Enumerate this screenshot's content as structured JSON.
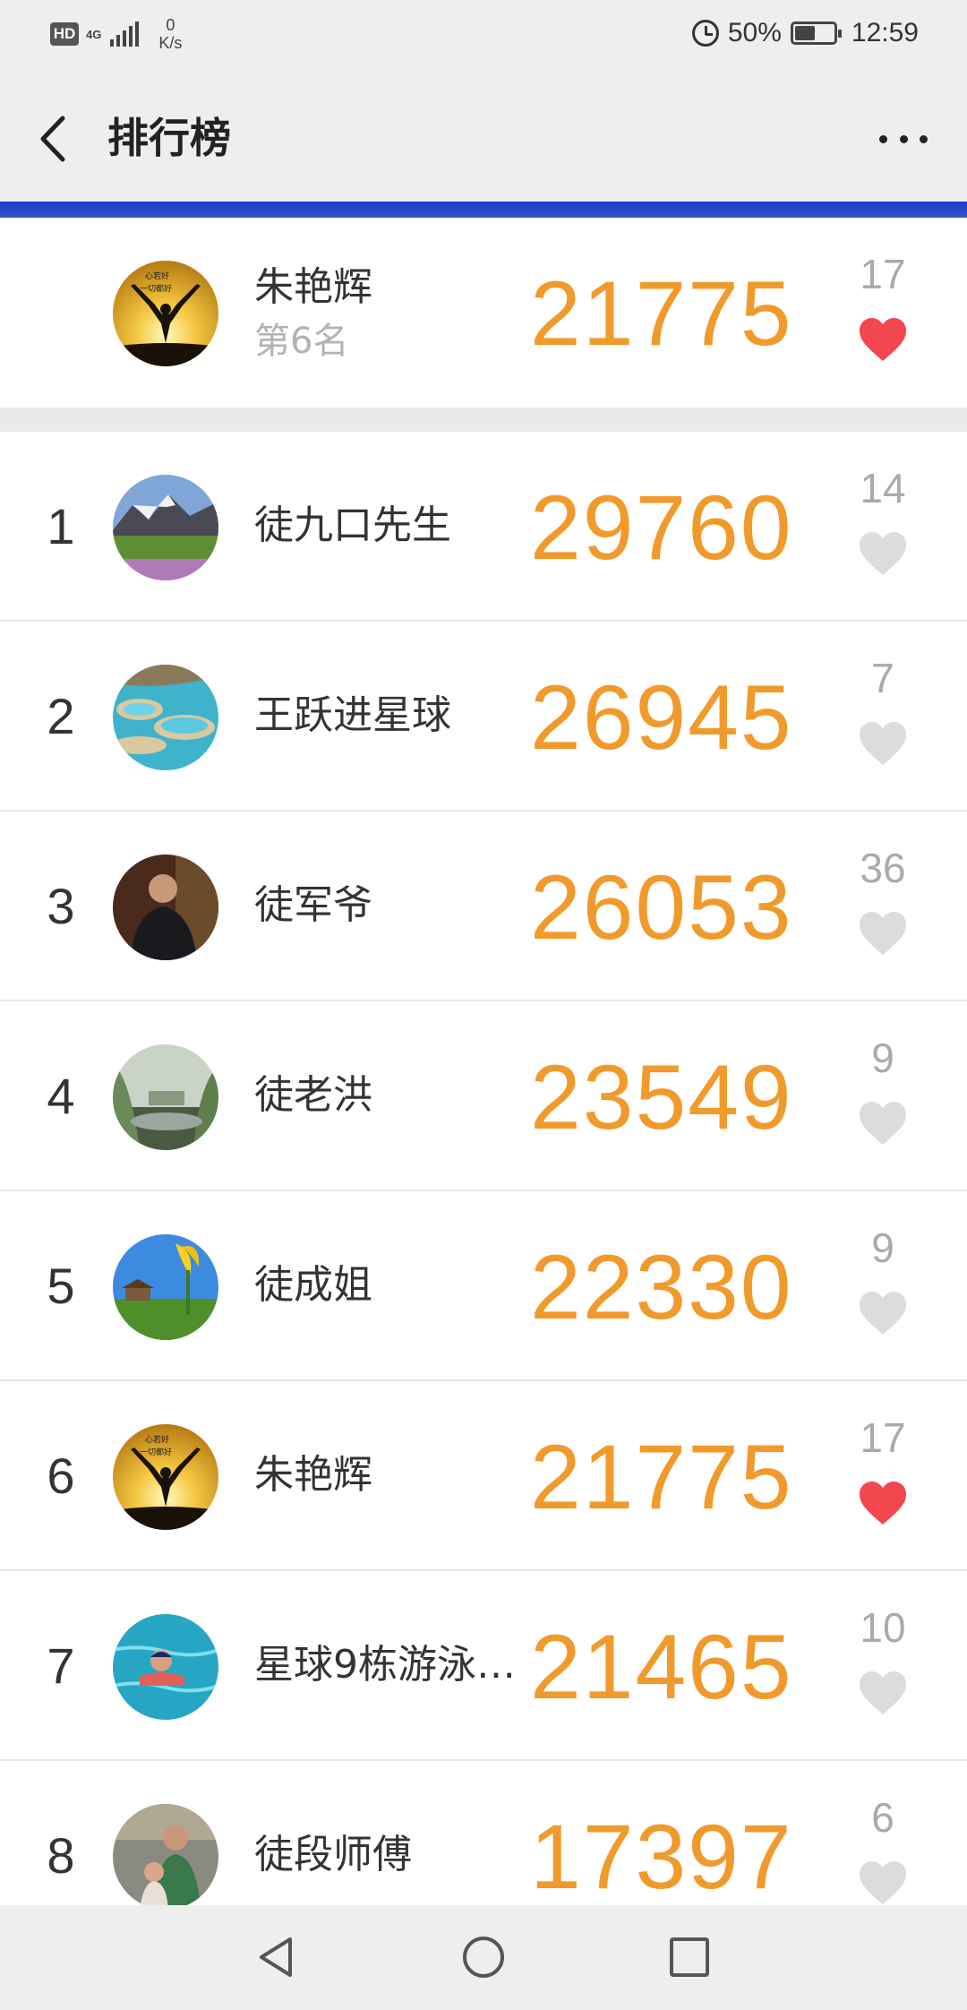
{
  "status_bar": {
    "hd": "HD",
    "network": "4G",
    "speed_value": "0",
    "speed_unit": "K/s",
    "battery": "50%",
    "time": "12:59"
  },
  "header": {
    "title": "排行榜"
  },
  "self_entry": {
    "name": "朱艳辉",
    "rank_label": "第6名",
    "score": "21775",
    "likes": "17",
    "liked": true
  },
  "ranking": [
    {
      "rank": "1",
      "name": "徒九口先生",
      "score": "29760",
      "likes": "14",
      "liked": false
    },
    {
      "rank": "2",
      "name": "王跃进星球",
      "score": "26945",
      "likes": "7",
      "liked": false
    },
    {
      "rank": "3",
      "name": "徒军爷",
      "score": "26053",
      "likes": "36",
      "liked": false
    },
    {
      "rank": "4",
      "name": "徒老洪",
      "score": "23549",
      "likes": "9",
      "liked": false
    },
    {
      "rank": "5",
      "name": "徒成姐",
      "score": "22330",
      "likes": "9",
      "liked": false
    },
    {
      "rank": "6",
      "name": "朱艳辉",
      "score": "21775",
      "likes": "17",
      "liked": true
    },
    {
      "rank": "7",
      "name": "星球9栋游泳…",
      "score": "21465",
      "likes": "10",
      "liked": false
    },
    {
      "rank": "8",
      "name": "徒段师傅",
      "score": "17397",
      "likes": "6",
      "liked": false
    }
  ],
  "colors": {
    "score": "#f19a2c",
    "heart_liked": "#f2474e",
    "heart_unliked": "#dcdcdc"
  }
}
